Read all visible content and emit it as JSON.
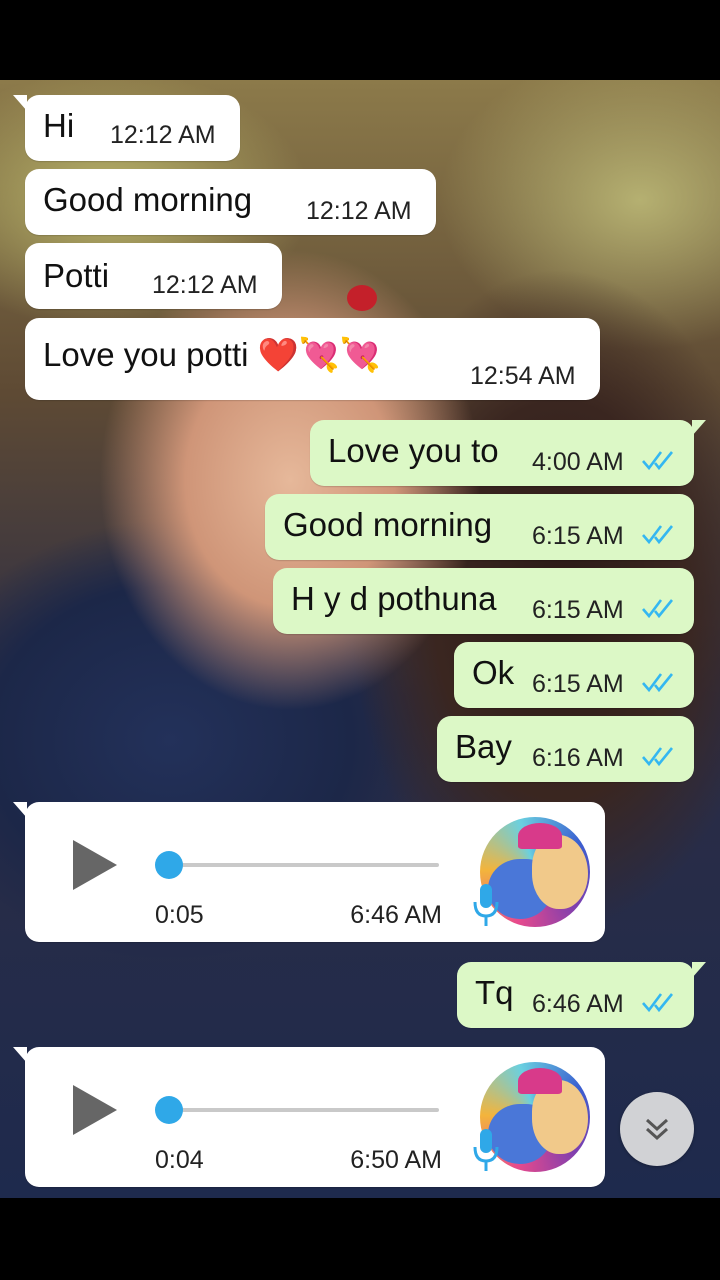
{
  "messages": [
    {
      "text": "Hi",
      "time": "12:12 AM"
    },
    {
      "text": "Good morning",
      "time": "12:12 AM"
    },
    {
      "text": "Potti",
      "time": "12:12 AM"
    },
    {
      "text": "Love you potti ❤️💘💘",
      "time": "12:54 AM"
    },
    {
      "text": "Love you to",
      "time": "4:00 AM"
    },
    {
      "text": "Good morning",
      "time": "6:15 AM"
    },
    {
      "text": "H y d pothuna",
      "time": "6:15 AM"
    },
    {
      "text": "Ok",
      "time": "6:15 AM"
    },
    {
      "text": "Bay",
      "time": "6:16 AM"
    },
    {
      "text": "Tq",
      "time": "6:46 AM"
    }
  ],
  "voice_notes": [
    {
      "duration": "0:05",
      "time": "6:46 AM",
      "progress": 0
    },
    {
      "duration": "0:04",
      "time": "6:50 AM",
      "progress": 0
    }
  ],
  "colors": {
    "incoming_bubble": "#ffffff",
    "outgoing_bubble": "#dcf8c6",
    "read_ticks": "#34b7f1",
    "voice_knob": "#2fa8e8"
  },
  "icons": {
    "play": "play-icon",
    "read_receipt": "double-check-icon",
    "mic": "microphone-icon",
    "scroll_down": "double-chevron-down-icon"
  }
}
